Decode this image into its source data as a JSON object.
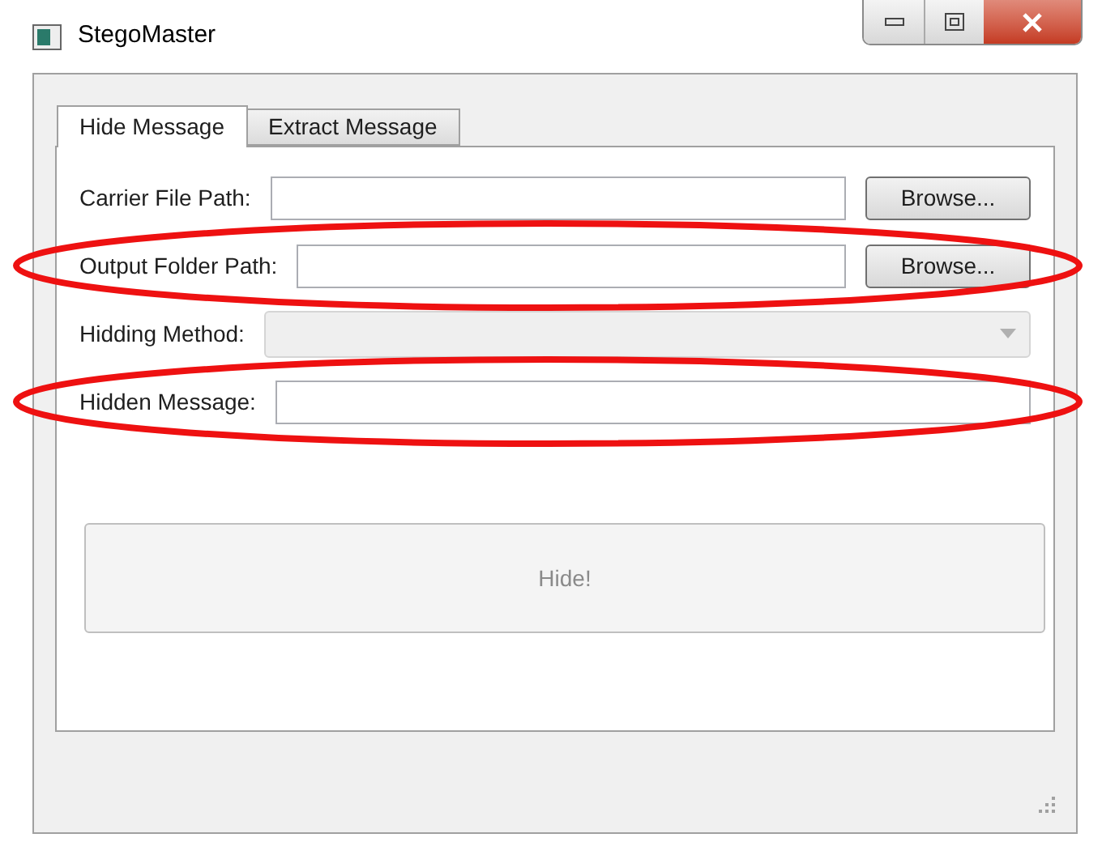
{
  "window": {
    "title": "StegoMaster"
  },
  "tabs": [
    {
      "label": "Hide Message",
      "selected": true
    },
    {
      "label": "Extract Message",
      "selected": false
    }
  ],
  "rows": [
    {
      "kind": "file",
      "label": "Carrier File Path:",
      "button": "Browse...",
      "highlighted": false
    },
    {
      "kind": "file",
      "label": "Output Folder Path:",
      "button": "Browse...",
      "highlighted": true
    },
    {
      "kind": "combo",
      "label": "Hidding Method:",
      "disabled": true,
      "highlighted": false
    },
    {
      "kind": "text",
      "label": "Hidden Message:",
      "highlighted": true
    }
  ],
  "action_button": {
    "label": "Hide!",
    "disabled": true
  }
}
